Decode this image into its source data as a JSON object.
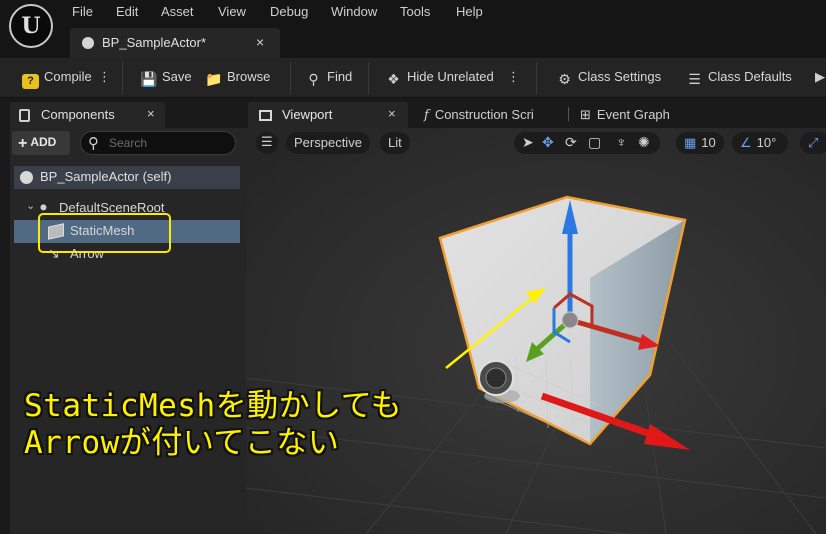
{
  "menu": [
    "File",
    "Edit",
    "Asset",
    "View",
    "Debug",
    "Window",
    "Tools",
    "Help"
  ],
  "logo_icon": "unreal-logo-icon",
  "document_tab": {
    "label": "BP_SampleActor*",
    "close": "×"
  },
  "toolbar": {
    "compile": "Compile",
    "save": "Save",
    "browse": "Browse",
    "find": "Find",
    "hide_unrelated": "Hide Unrelated",
    "class_settings": "Class Settings",
    "class_defaults": "Class Defaults",
    "more": "⋮"
  },
  "components_panel": {
    "title": "Components",
    "close": "×",
    "add_label": "ADD",
    "search_placeholder": "Search",
    "self_item": "BP_SampleActor (self)",
    "tree": [
      {
        "label": "DefaultSceneRoot",
        "icon": "scene-root-icon"
      },
      {
        "label": "StaticMesh",
        "icon": "static-mesh-icon",
        "selected": true
      },
      {
        "label": "Arrow",
        "icon": "arrow-component-icon"
      }
    ]
  },
  "editor_tabs": {
    "viewport": "Viewport",
    "viewport_close": "×",
    "construction": "Construction Scri",
    "event_graph": "Event Graph"
  },
  "viewport_toolbar": {
    "perspective": "Perspective",
    "lit": "Lit",
    "grid_snap": "10",
    "rotation_snap": "10°"
  },
  "annotation": {
    "line1": "StaticMeshを動かしても",
    "line2": "Arrowが付いてこない"
  },
  "colors": {
    "highlight": "#ffe900",
    "annotation_text": "#fff200",
    "selection_outline": "#f0a030",
    "axis_x": "#e02020",
    "axis_y": "#58a020",
    "axis_z": "#2a78e0"
  }
}
